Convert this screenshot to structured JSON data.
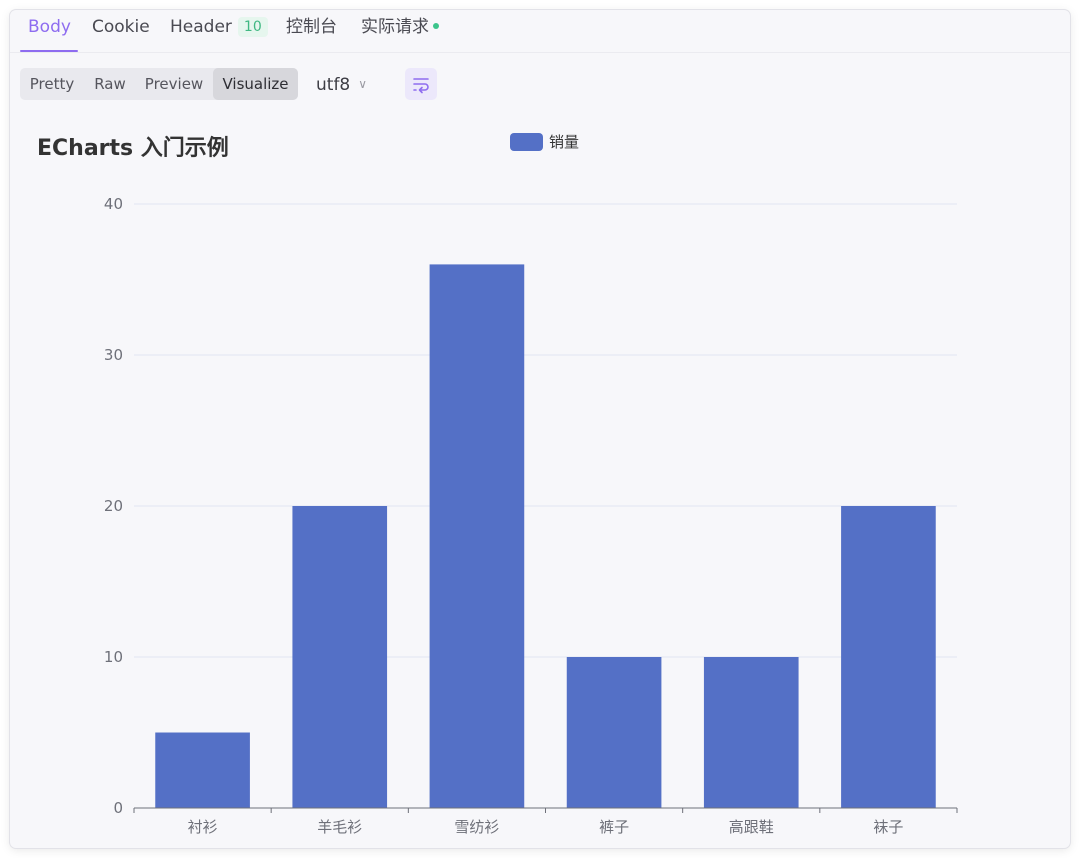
{
  "tabs": [
    {
      "label": "Body",
      "active": true
    },
    {
      "label": "Cookie"
    },
    {
      "label": "Header",
      "badge": "10"
    },
    {
      "label": "控制台"
    },
    {
      "label": "实际请求",
      "indicator": true
    }
  ],
  "view_modes": [
    {
      "label": "Pretty"
    },
    {
      "label": "Raw"
    },
    {
      "label": "Preview"
    },
    {
      "label": "Visualize",
      "active": true
    }
  ],
  "encoding": {
    "value": "utf8"
  },
  "icons": {
    "wrap": "wrap-lines-icon",
    "encoding_chevron": "chevron-down-icon"
  },
  "colors": {
    "accent": "#8e6cf0",
    "bar": "#5470c6",
    "status_dot": "#3cc48b"
  },
  "chart_data": {
    "type": "bar",
    "title": "ECharts 入门示例",
    "legend": {
      "position": "top-center"
    },
    "categories": [
      "衬衫",
      "羊毛衫",
      "雪纺衫",
      "裤子",
      "高跟鞋",
      "袜子"
    ],
    "series": [
      {
        "name": "销量",
        "values": [
          5,
          20,
          36,
          10,
          10,
          20
        ]
      }
    ],
    "yticks": [
      0,
      10,
      20,
      30,
      40
    ],
    "ylim": [
      0,
      40
    ],
    "grid": true
  }
}
